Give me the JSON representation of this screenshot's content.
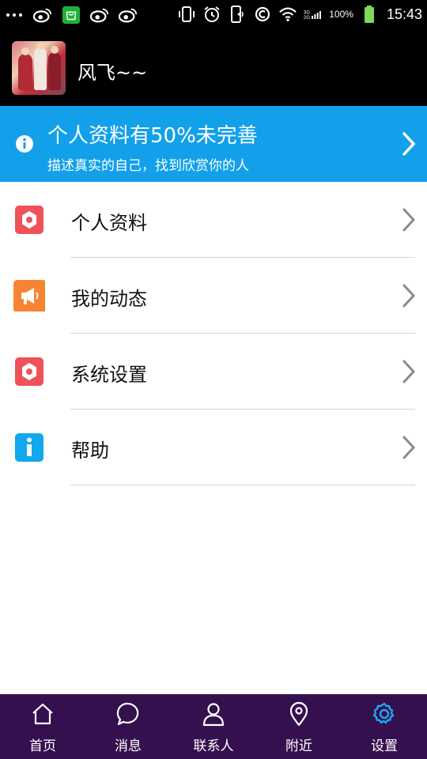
{
  "status_bar": {
    "battery": "100%",
    "time": "15:43"
  },
  "profile": {
    "username": "风飞~~"
  },
  "banner": {
    "title": "个人资料有50%未完善",
    "subtitle": "描述真实的自己，找到欣赏你的人"
  },
  "menu": {
    "items": [
      {
        "label": "个人资料",
        "icon": "hexagon-icon",
        "color": "#f0525a"
      },
      {
        "label": "我的动态",
        "icon": "megaphone-icon",
        "color": "#f78433"
      },
      {
        "label": "系统设置",
        "icon": "hexagon-icon",
        "color": "#f0525a"
      },
      {
        "label": "帮助",
        "icon": "info-icon",
        "color": "#11a8ee"
      }
    ]
  },
  "tabbar": {
    "tabs": [
      {
        "label": "首页",
        "icon": "home-icon"
      },
      {
        "label": "消息",
        "icon": "chat-bubble-icon"
      },
      {
        "label": "联系人",
        "icon": "person-icon"
      },
      {
        "label": "附近",
        "icon": "location-pin-icon"
      },
      {
        "label": "设置",
        "icon": "gear-icon",
        "active": true
      }
    ],
    "background": "#35104f",
    "active_color": "#1fa8f2"
  },
  "colors": {
    "banner": "#12a0ea",
    "header": "#000000"
  }
}
